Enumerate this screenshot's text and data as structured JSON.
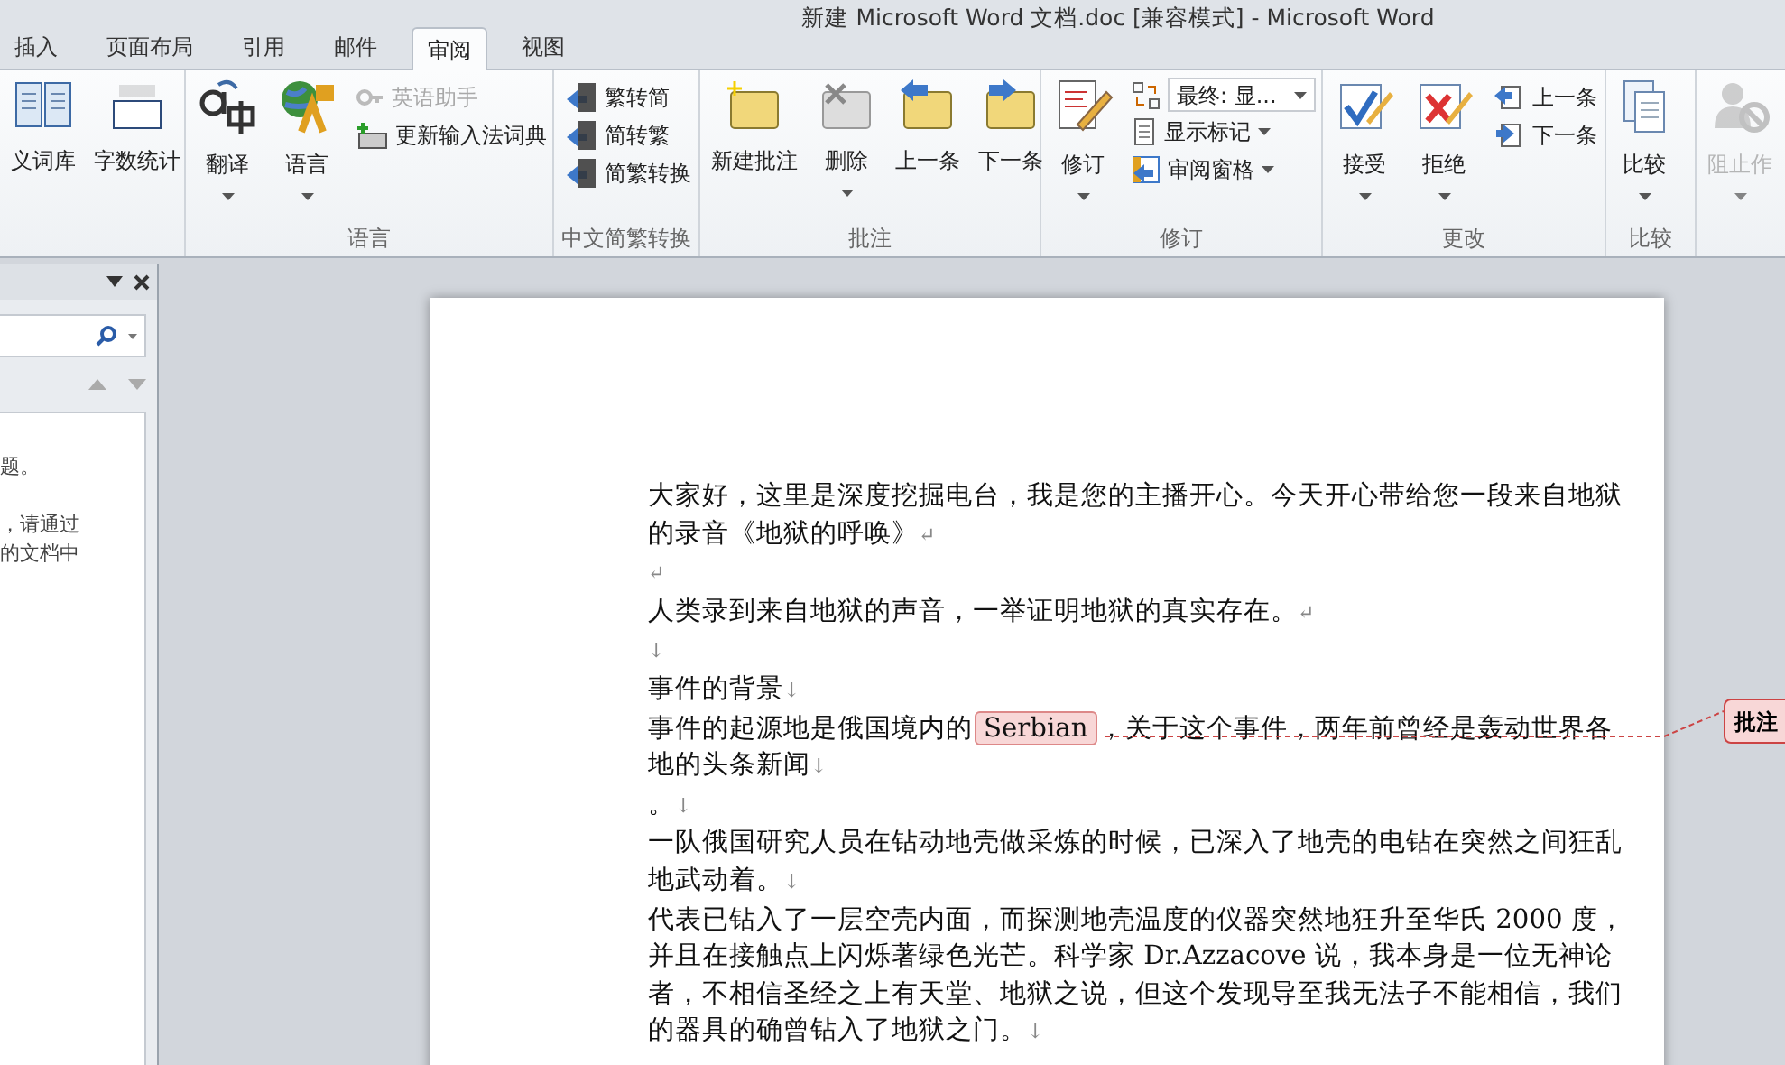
{
  "window": {
    "title": "新建 Microsoft Word 文档.doc [兼容模式]  -  Microsoft Word"
  },
  "tabs": [
    {
      "label": "插入",
      "selected": false
    },
    {
      "label": "页面布局",
      "selected": false
    },
    {
      "label": "引用",
      "selected": false
    },
    {
      "label": "邮件",
      "selected": false
    },
    {
      "label": "审阅",
      "selected": true
    },
    {
      "label": "视图",
      "selected": false
    }
  ],
  "ribbon_groups": [
    {
      "items": [
        {
          "kind": "large",
          "label": "义词库",
          "dropdown": false,
          "disabled": false
        },
        {
          "kind": "large",
          "label": "字数统计",
          "dropdown": false,
          "disabled": false
        }
      ]
    },
    {
      "label": "语言",
      "items": [
        {
          "kind": "large",
          "label": "翻译",
          "dropdown": true,
          "disabled": false
        },
        {
          "kind": "large",
          "label": "语言",
          "dropdown": true,
          "disabled": false
        },
        {
          "kind": "stack",
          "items": [
            {
              "label": "英语助手",
              "dropdown": false,
              "disabled": true
            },
            {
              "label": "更新输入法词典",
              "dropdown": false,
              "disabled": false
            }
          ]
        }
      ]
    },
    {
      "label": "中文简繁转换",
      "items": [
        {
          "kind": "stack",
          "items": [
            {
              "label": "繁转简",
              "dropdown": false,
              "disabled": false
            },
            {
              "label": "简转繁",
              "dropdown": false,
              "disabled": false
            },
            {
              "label": "简繁转换",
              "dropdown": false,
              "disabled": false
            }
          ]
        }
      ]
    },
    {
      "label": "批注",
      "items": [
        {
          "kind": "large",
          "label": "新建批注",
          "dropdown": false,
          "disabled": false
        },
        {
          "kind": "large",
          "label": "删除",
          "dropdown": true,
          "disabled": false
        },
        {
          "kind": "large",
          "label": "上一条",
          "dropdown": false,
          "disabled": false
        },
        {
          "kind": "large",
          "label": "下一条",
          "dropdown": false,
          "disabled": false
        }
      ]
    },
    {
      "label": "修订",
      "items": [
        {
          "kind": "large",
          "label": "修订",
          "dropdown": true,
          "disabled": false
        },
        {
          "kind": "stack",
          "items": [
            {
              "kind": "combo",
              "label": "最终: 显...",
              "dropdown": true,
              "disabled": false
            },
            {
              "label": "显示标记",
              "dropdown": true,
              "disabled": false
            },
            {
              "label": "审阅窗格",
              "dropdown": true,
              "disabled": false
            }
          ]
        }
      ]
    },
    {
      "label": "更改",
      "items": [
        {
          "kind": "large",
          "label": "接受",
          "dropdown": true,
          "disabled": false
        },
        {
          "kind": "large",
          "label": "拒绝",
          "dropdown": true,
          "disabled": false
        },
        {
          "kind": "stack",
          "items": [
            {
              "label": "上一条",
              "dropdown": false,
              "disabled": false
            },
            {
              "label": "下一条",
              "dropdown": false,
              "disabled": false
            }
          ]
        }
      ]
    },
    {
      "label": "比较",
      "items": [
        {
          "kind": "large",
          "label": "比较",
          "dropdown": true,
          "disabled": false
        }
      ]
    },
    {
      "items": [
        {
          "kind": "large",
          "label": "阻止作",
          "dropdown": true,
          "disabled": true
        }
      ]
    }
  ],
  "nav_pane": {
    "lines": [
      "题。",
      "，请通过",
      "的文档中"
    ]
  },
  "document": {
    "paragraphs": [
      {
        "segments": [
          {
            "text": "大家好，这里是深度挖掘电台，我是您的主播开心。今天开心带给您一段来自地狱的录音《地狱的呼唤》",
            "commented": false
          }
        ],
        "mark": "↵"
      },
      {
        "mark": "↵"
      },
      {
        "segments": [
          {
            "text": "人类录到来自地狱的声音，一举证明地狱的真实存在。",
            "commented": false
          }
        ],
        "mark": "↵"
      },
      {
        "mark": "↓"
      },
      {
        "segments": [
          {
            "text": "事件的背景",
            "commented": false
          }
        ],
        "mark": "↓"
      },
      {
        "segments": [
          {
            "text": "事件的起源地是俄国境内的",
            "commented": false
          },
          {
            "text": "Serbian",
            "commented": true
          },
          {
            "text": "，关于这个事件，两年前曾经是轰动世界各地的头条新闻",
            "commented": false
          }
        ],
        "mark": "↓"
      },
      {
        "segments": [
          {
            "text": "。",
            "commented": false
          }
        ],
        "mark": "↓"
      },
      {
        "segments": [
          {
            "text": "一队俄国研究人员在钻动地壳做采炼的时候，已深入了地壳的电钻在突然之间狂乱地武动着。",
            "commented": false
          }
        ],
        "mark": "↓"
      },
      {
        "segments": [
          {
            "text": "代表已钻入了一层空壳内面，而探测地壳温度的仪器突然地狂升至华氏 2000 度，并且在接触点上闪烁著绿色光芒。科学家 Dr.Azzacove 说，我本身是一位无神论者，不相信圣经之上有天堂、地狱之说，但这个发现导至我无法子不能相信，我们的器具的确曾钻入了地狱之门。",
            "commented": false
          }
        ],
        "mark": "↓"
      }
    ]
  },
  "comment_balloon": {
    "label": "批注"
  }
}
